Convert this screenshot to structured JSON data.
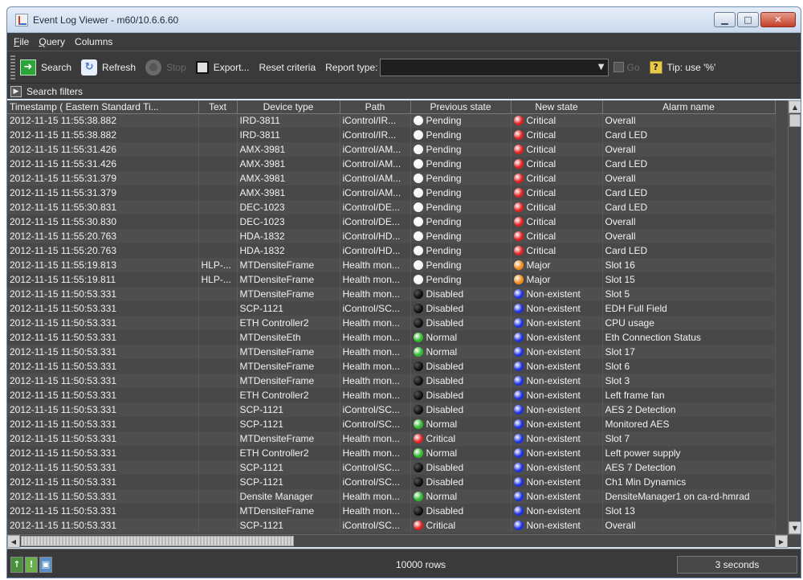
{
  "window": {
    "title": "Event Log Viewer - m60/10.6.6.60"
  },
  "menu": [
    "File",
    "Query",
    "Columns"
  ],
  "toolbar": {
    "search": "Search",
    "refresh": "Refresh",
    "stop": "Stop",
    "export": "Export...",
    "reset": "Reset criteria",
    "report_type_label": "Report type:",
    "report_type_value": "",
    "go": "Go",
    "tip": "Tip: use '%'"
  },
  "filters": {
    "label": "Search filters"
  },
  "columns": [
    "Timestamp ( Eastern Standard Ti...",
    "Text",
    "Device type",
    "Path",
    "Previous state",
    "New state",
    "Alarm name"
  ],
  "state_colors": {
    "Pending": "#f4f4f4",
    "Critical": "#e02020",
    "Major": "#f08c1e",
    "Disabled": "#1a1a1a",
    "Normal": "#2eb82e",
    "Non-existent": "#1d2fe0"
  },
  "rows": [
    [
      "2012-11-15 11:55:38.882",
      "",
      "IRD-3811",
      "iControl/IR...",
      "Pending",
      "Critical",
      "Overall"
    ],
    [
      "2012-11-15 11:55:38.882",
      "",
      "IRD-3811",
      "iControl/IR...",
      "Pending",
      "Critical",
      "Card LED"
    ],
    [
      "2012-11-15 11:55:31.426",
      "",
      "AMX-3981",
      "iControl/AM...",
      "Pending",
      "Critical",
      "Overall"
    ],
    [
      "2012-11-15 11:55:31.426",
      "",
      "AMX-3981",
      "iControl/AM...",
      "Pending",
      "Critical",
      "Card LED"
    ],
    [
      "2012-11-15 11:55:31.379",
      "",
      "AMX-3981",
      "iControl/AM...",
      "Pending",
      "Critical",
      "Overall"
    ],
    [
      "2012-11-15 11:55:31.379",
      "",
      "AMX-3981",
      "iControl/AM...",
      "Pending",
      "Critical",
      "Card LED"
    ],
    [
      "2012-11-15 11:55:30.831",
      "",
      "DEC-1023",
      "iControl/DE...",
      "Pending",
      "Critical",
      "Card LED"
    ],
    [
      "2012-11-15 11:55:30.830",
      "",
      "DEC-1023",
      "iControl/DE...",
      "Pending",
      "Critical",
      "Overall"
    ],
    [
      "2012-11-15 11:55:20.763",
      "",
      "HDA-1832",
      "iControl/HD...",
      "Pending",
      "Critical",
      "Overall"
    ],
    [
      "2012-11-15 11:55:20.763",
      "",
      "HDA-1832",
      "iControl/HD...",
      "Pending",
      "Critical",
      "Card LED"
    ],
    [
      "2012-11-15 11:55:19.813",
      "HLP-...",
      "MTDensiteFrame",
      "Health mon...",
      "Pending",
      "Major",
      "Slot 16"
    ],
    [
      "2012-11-15 11:55:19.811",
      "HLP-...",
      "MTDensiteFrame",
      "Health mon...",
      "Pending",
      "Major",
      "Slot 15"
    ],
    [
      "2012-11-15 11:50:53.331",
      "",
      "MTDensiteFrame",
      "Health mon...",
      "Disabled",
      "Non-existent",
      "Slot 5"
    ],
    [
      "2012-11-15 11:50:53.331",
      "",
      "SCP-1121",
      "iControl/SC...",
      "Disabled",
      "Non-existent",
      "EDH Full Field"
    ],
    [
      "2012-11-15 11:50:53.331",
      "",
      "ETH Controller2",
      "Health mon...",
      "Disabled",
      "Non-existent",
      "CPU usage"
    ],
    [
      "2012-11-15 11:50:53.331",
      "",
      "MTDensiteEth",
      "Health mon...",
      "Normal",
      "Non-existent",
      "Eth Connection Status"
    ],
    [
      "2012-11-15 11:50:53.331",
      "",
      "MTDensiteFrame",
      "Health mon...",
      "Normal",
      "Non-existent",
      "Slot 17"
    ],
    [
      "2012-11-15 11:50:53.331",
      "",
      "MTDensiteFrame",
      "Health mon...",
      "Disabled",
      "Non-existent",
      "Slot 6"
    ],
    [
      "2012-11-15 11:50:53.331",
      "",
      "MTDensiteFrame",
      "Health mon...",
      "Disabled",
      "Non-existent",
      "Slot 3"
    ],
    [
      "2012-11-15 11:50:53.331",
      "",
      "ETH Controller2",
      "Health mon...",
      "Disabled",
      "Non-existent",
      "Left frame fan"
    ],
    [
      "2012-11-15 11:50:53.331",
      "",
      "SCP-1121",
      "iControl/SC...",
      "Disabled",
      "Non-existent",
      "AES 2 Detection"
    ],
    [
      "2012-11-15 11:50:53.331",
      "",
      "SCP-1121",
      "iControl/SC...",
      "Normal",
      "Non-existent",
      "Monitored AES"
    ],
    [
      "2012-11-15 11:50:53.331",
      "",
      "MTDensiteFrame",
      "Health mon...",
      "Critical",
      "Non-existent",
      "Slot 7"
    ],
    [
      "2012-11-15 11:50:53.331",
      "",
      "ETH Controller2",
      "Health mon...",
      "Normal",
      "Non-existent",
      "Left power supply"
    ],
    [
      "2012-11-15 11:50:53.331",
      "",
      "SCP-1121",
      "iControl/SC...",
      "Disabled",
      "Non-existent",
      "AES 7 Detection"
    ],
    [
      "2012-11-15 11:50:53.331",
      "",
      "SCP-1121",
      "iControl/SC...",
      "Disabled",
      "Non-existent",
      "Ch1 Min Dynamics"
    ],
    [
      "2012-11-15 11:50:53.331",
      "",
      "Densite Manager",
      "Health mon...",
      "Normal",
      "Non-existent",
      "DensiteManager1 on ca-rd-hmrad"
    ],
    [
      "2012-11-15 11:50:53.331",
      "",
      "MTDensiteFrame",
      "Health mon...",
      "Disabled",
      "Non-existent",
      "Slot 13"
    ],
    [
      "2012-11-15 11:50:53.331",
      "",
      "SCP-1121",
      "iControl/SC...",
      "Critical",
      "Non-existent",
      "Overall"
    ]
  ],
  "status": {
    "rows": "10000 rows",
    "time": "3 seconds"
  }
}
